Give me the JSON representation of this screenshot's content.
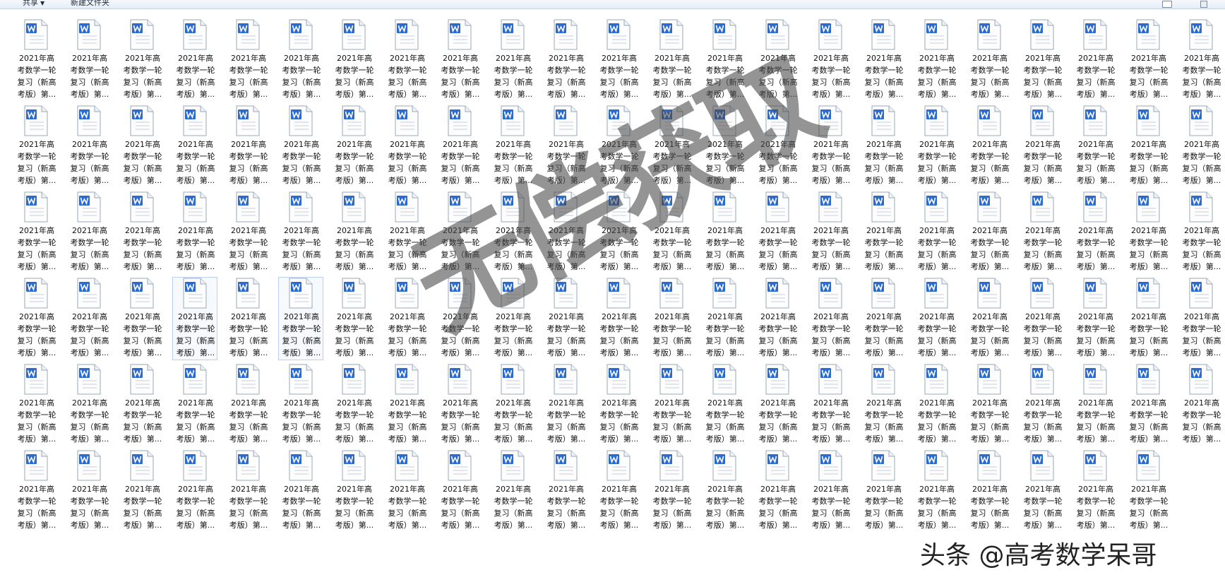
{
  "toolbar": {
    "share_label": "共享",
    "new_folder_label": "新建文件夹"
  },
  "icons": {
    "file_icon": "word-document-icon",
    "accent": "#2b6bd1"
  },
  "files": {
    "rows": 6,
    "columns": 23,
    "last_row_columns": 22,
    "name_line1": "2021年高",
    "name_line2": "考数学一轮",
    "name_line3": "复习（新高",
    "name_line4": "考版）第..."
  },
  "watermark": {
    "text": "无偿获取",
    "credit": "头条 @高考数学呆哥"
  }
}
